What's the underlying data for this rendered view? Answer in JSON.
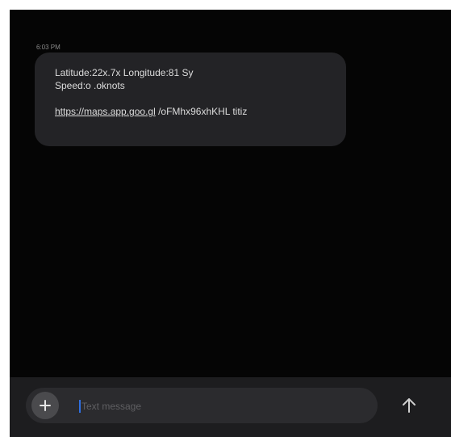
{
  "conversation": {
    "message": {
      "timestamp": "6:03 PM",
      "line1": "Latitude:22x.7x Longitude:81 Sy",
      "line2": "Speed:o .oknots",
      "link": "https://maps.app.goo.gl",
      "link_suffix": " /oFMhx96xhKHL titiz"
    }
  },
  "composer": {
    "placeholder": "Text message",
    "add_icon": "plus-icon",
    "send_icon": "arrow-up-icon"
  },
  "colors": {
    "background": "#050505",
    "bubble": "#232326",
    "composer_bar": "#1d1d1f",
    "caret": "#2f6fe0"
  }
}
